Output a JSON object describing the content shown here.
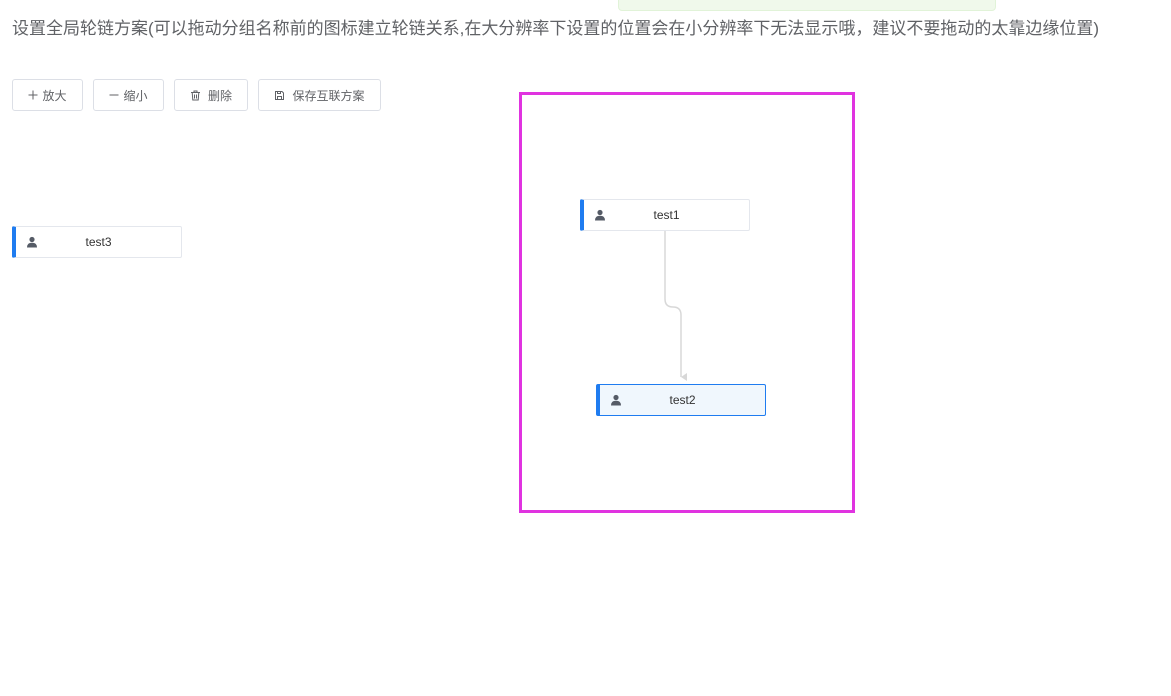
{
  "header": {
    "title": "设置全局轮链方案(可以拖动分组名称前的图标建立轮链关系,在大分辨率下设置的位置会在小分辨率下无法显示哦，建议不要拖动的太靠边缘位置)"
  },
  "toolbar": {
    "zoom_in_label": "放大",
    "zoom_out_label": "缩小",
    "delete_label": "删除",
    "save_label": "保存互联方案"
  },
  "nodes": [
    {
      "label": "test1",
      "icon": "user-icon",
      "selected": false
    },
    {
      "label": "test2",
      "icon": "user-icon",
      "selected": true
    },
    {
      "label": "test3",
      "icon": "user-icon",
      "selected": false
    }
  ],
  "edges": [
    {
      "from": "test1",
      "to": "test2"
    }
  ],
  "colors": {
    "accent": "#1f7cf0",
    "highlight": "#e033e0",
    "edge": "#d8d8d8"
  }
}
